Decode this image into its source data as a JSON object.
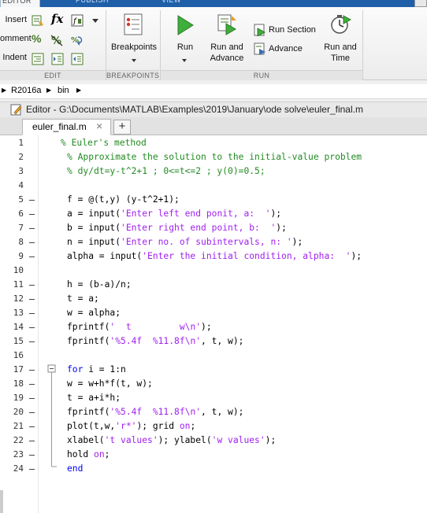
{
  "top_tabs": [
    "EDITOR",
    "PUBLISH",
    "VIEW"
  ],
  "ribbon": {
    "edit": {
      "group_label": "EDIT",
      "rows": [
        {
          "label": "Insert"
        },
        {
          "label": "omment"
        },
        {
          "label": "Indent"
        }
      ],
      "fx_label": "fx"
    },
    "breakpoints": {
      "group_label": "BREAKPOINTS",
      "button_label": "Breakpoints"
    },
    "run": {
      "group_label": "RUN",
      "run_label": "Run",
      "run_advance_line1": "Run and",
      "run_advance_line2": "Advance",
      "run_section_label": "Run Section",
      "advance_label": "Advance",
      "run_time_line1": "Run and",
      "run_time_line2": "Time"
    }
  },
  "address": {
    "segments": [
      "R2016a",
      "bin"
    ]
  },
  "editor": {
    "title": "Editor - G:\\Documents\\MATLAB\\Examples\\2019\\January\\ode solve\\euler_final.m",
    "tab_label": "euler_final.m",
    "close_glyph": "×",
    "add_glyph": "+"
  },
  "code": {
    "lines": [
      {
        "n": "1",
        "dash": false,
        "indent": 1,
        "tokens": [
          {
            "t": "cm",
            "v": "% Euler's method"
          }
        ]
      },
      {
        "n": "2",
        "dash": false,
        "indent": 2,
        "tokens": [
          {
            "t": "cm",
            "v": "% Approximate the solution to the initial-value problem"
          }
        ]
      },
      {
        "n": "3",
        "dash": false,
        "indent": 2,
        "tokens": [
          {
            "t": "cm",
            "v": "% dy/dt=y-t^2+1 ; 0<=t<=2 ; y(0)=0.5;"
          }
        ]
      },
      {
        "n": "4",
        "dash": false,
        "indent": 2,
        "tokens": []
      },
      {
        "n": "5",
        "dash": true,
        "indent": 2,
        "tokens": [
          {
            "t": "pl",
            "v": "f = @(t,y) (y-t^2+1);"
          }
        ]
      },
      {
        "n": "6",
        "dash": true,
        "indent": 2,
        "tokens": [
          {
            "t": "pl",
            "v": "a = input("
          },
          {
            "t": "st",
            "v": "'Enter left end ponit, a:  '"
          },
          {
            "t": "pl",
            "v": ");"
          }
        ]
      },
      {
        "n": "7",
        "dash": true,
        "indent": 2,
        "tokens": [
          {
            "t": "pl",
            "v": "b = input("
          },
          {
            "t": "st",
            "v": "'Enter right end point, b:  '"
          },
          {
            "t": "pl",
            "v": ");"
          }
        ]
      },
      {
        "n": "8",
        "dash": true,
        "indent": 2,
        "tokens": [
          {
            "t": "pl",
            "v": "n = input("
          },
          {
            "t": "st",
            "v": "'Enter no. of subintervals, n: '"
          },
          {
            "t": "pl",
            "v": ");"
          }
        ]
      },
      {
        "n": "9",
        "dash": true,
        "indent": 2,
        "tokens": [
          {
            "t": "pl",
            "v": "alpha = input("
          },
          {
            "t": "st",
            "v": "'Enter the initial condition, alpha:  '"
          },
          {
            "t": "pl",
            "v": ");"
          }
        ]
      },
      {
        "n": "10",
        "dash": false,
        "indent": 2,
        "tokens": []
      },
      {
        "n": "11",
        "dash": true,
        "indent": 2,
        "tokens": [
          {
            "t": "pl",
            "v": "h = (b-a)/n;"
          }
        ]
      },
      {
        "n": "12",
        "dash": true,
        "indent": 2,
        "tokens": [
          {
            "t": "pl",
            "v": "t = a;"
          }
        ]
      },
      {
        "n": "13",
        "dash": true,
        "indent": 2,
        "tokens": [
          {
            "t": "pl",
            "v": "w = alpha;"
          }
        ]
      },
      {
        "n": "14",
        "dash": true,
        "indent": 2,
        "tokens": [
          {
            "t": "pl",
            "v": "fprintf("
          },
          {
            "t": "st",
            "v": "'  t         w\\n'"
          },
          {
            "t": "pl",
            "v": ");"
          }
        ]
      },
      {
        "n": "15",
        "dash": true,
        "indent": 2,
        "tokens": [
          {
            "t": "pl",
            "v": "fprintf("
          },
          {
            "t": "st",
            "v": "'%5.4f  %11.8f\\n'"
          },
          {
            "t": "pl",
            "v": ", t, w);"
          }
        ]
      },
      {
        "n": "16",
        "dash": false,
        "indent": 2,
        "tokens": []
      },
      {
        "n": "17",
        "dash": true,
        "indent": 2,
        "fold": true,
        "tokens": [
          {
            "t": "kw",
            "v": "for"
          },
          {
            "t": "pl",
            "v": " i = 1:n"
          }
        ]
      },
      {
        "n": "18",
        "dash": true,
        "indent": 2,
        "tokens": [
          {
            "t": "pl",
            "v": "w = w+h*f(t, w);"
          }
        ]
      },
      {
        "n": "19",
        "dash": true,
        "indent": 2,
        "tokens": [
          {
            "t": "pl",
            "v": "t = a+i*h;"
          }
        ]
      },
      {
        "n": "20",
        "dash": true,
        "indent": 2,
        "tokens": [
          {
            "t": "pl",
            "v": "fprintf("
          },
          {
            "t": "st",
            "v": "'%5.4f  %11.8f\\n'"
          },
          {
            "t": "pl",
            "v": ", t, w);"
          }
        ]
      },
      {
        "n": "21",
        "dash": true,
        "indent": 2,
        "tokens": [
          {
            "t": "pl",
            "v": "plot(t,w,"
          },
          {
            "t": "st",
            "v": "'r*'"
          },
          {
            "t": "pl",
            "v": "); grid "
          },
          {
            "t": "st",
            "v": "on"
          },
          {
            "t": "pl",
            "v": ";"
          }
        ]
      },
      {
        "n": "22",
        "dash": true,
        "indent": 2,
        "tokens": [
          {
            "t": "pl",
            "v": "xlabel("
          },
          {
            "t": "st",
            "v": "'t values'"
          },
          {
            "t": "pl",
            "v": "); ylabel("
          },
          {
            "t": "st",
            "v": "'w values'"
          },
          {
            "t": "pl",
            "v": ");"
          }
        ]
      },
      {
        "n": "23",
        "dash": true,
        "indent": 2,
        "tokens": [
          {
            "t": "pl",
            "v": "hold "
          },
          {
            "t": "st",
            "v": "on"
          },
          {
            "t": "pl",
            "v": ";"
          }
        ]
      },
      {
        "n": "24",
        "dash": true,
        "indent": 2,
        "foldend": true,
        "tokens": [
          {
            "t": "kw",
            "v": "end"
          }
        ]
      }
    ]
  },
  "colors": {
    "comment": "#228b22",
    "string": "#a020f0",
    "keyword": "#0000ff"
  }
}
